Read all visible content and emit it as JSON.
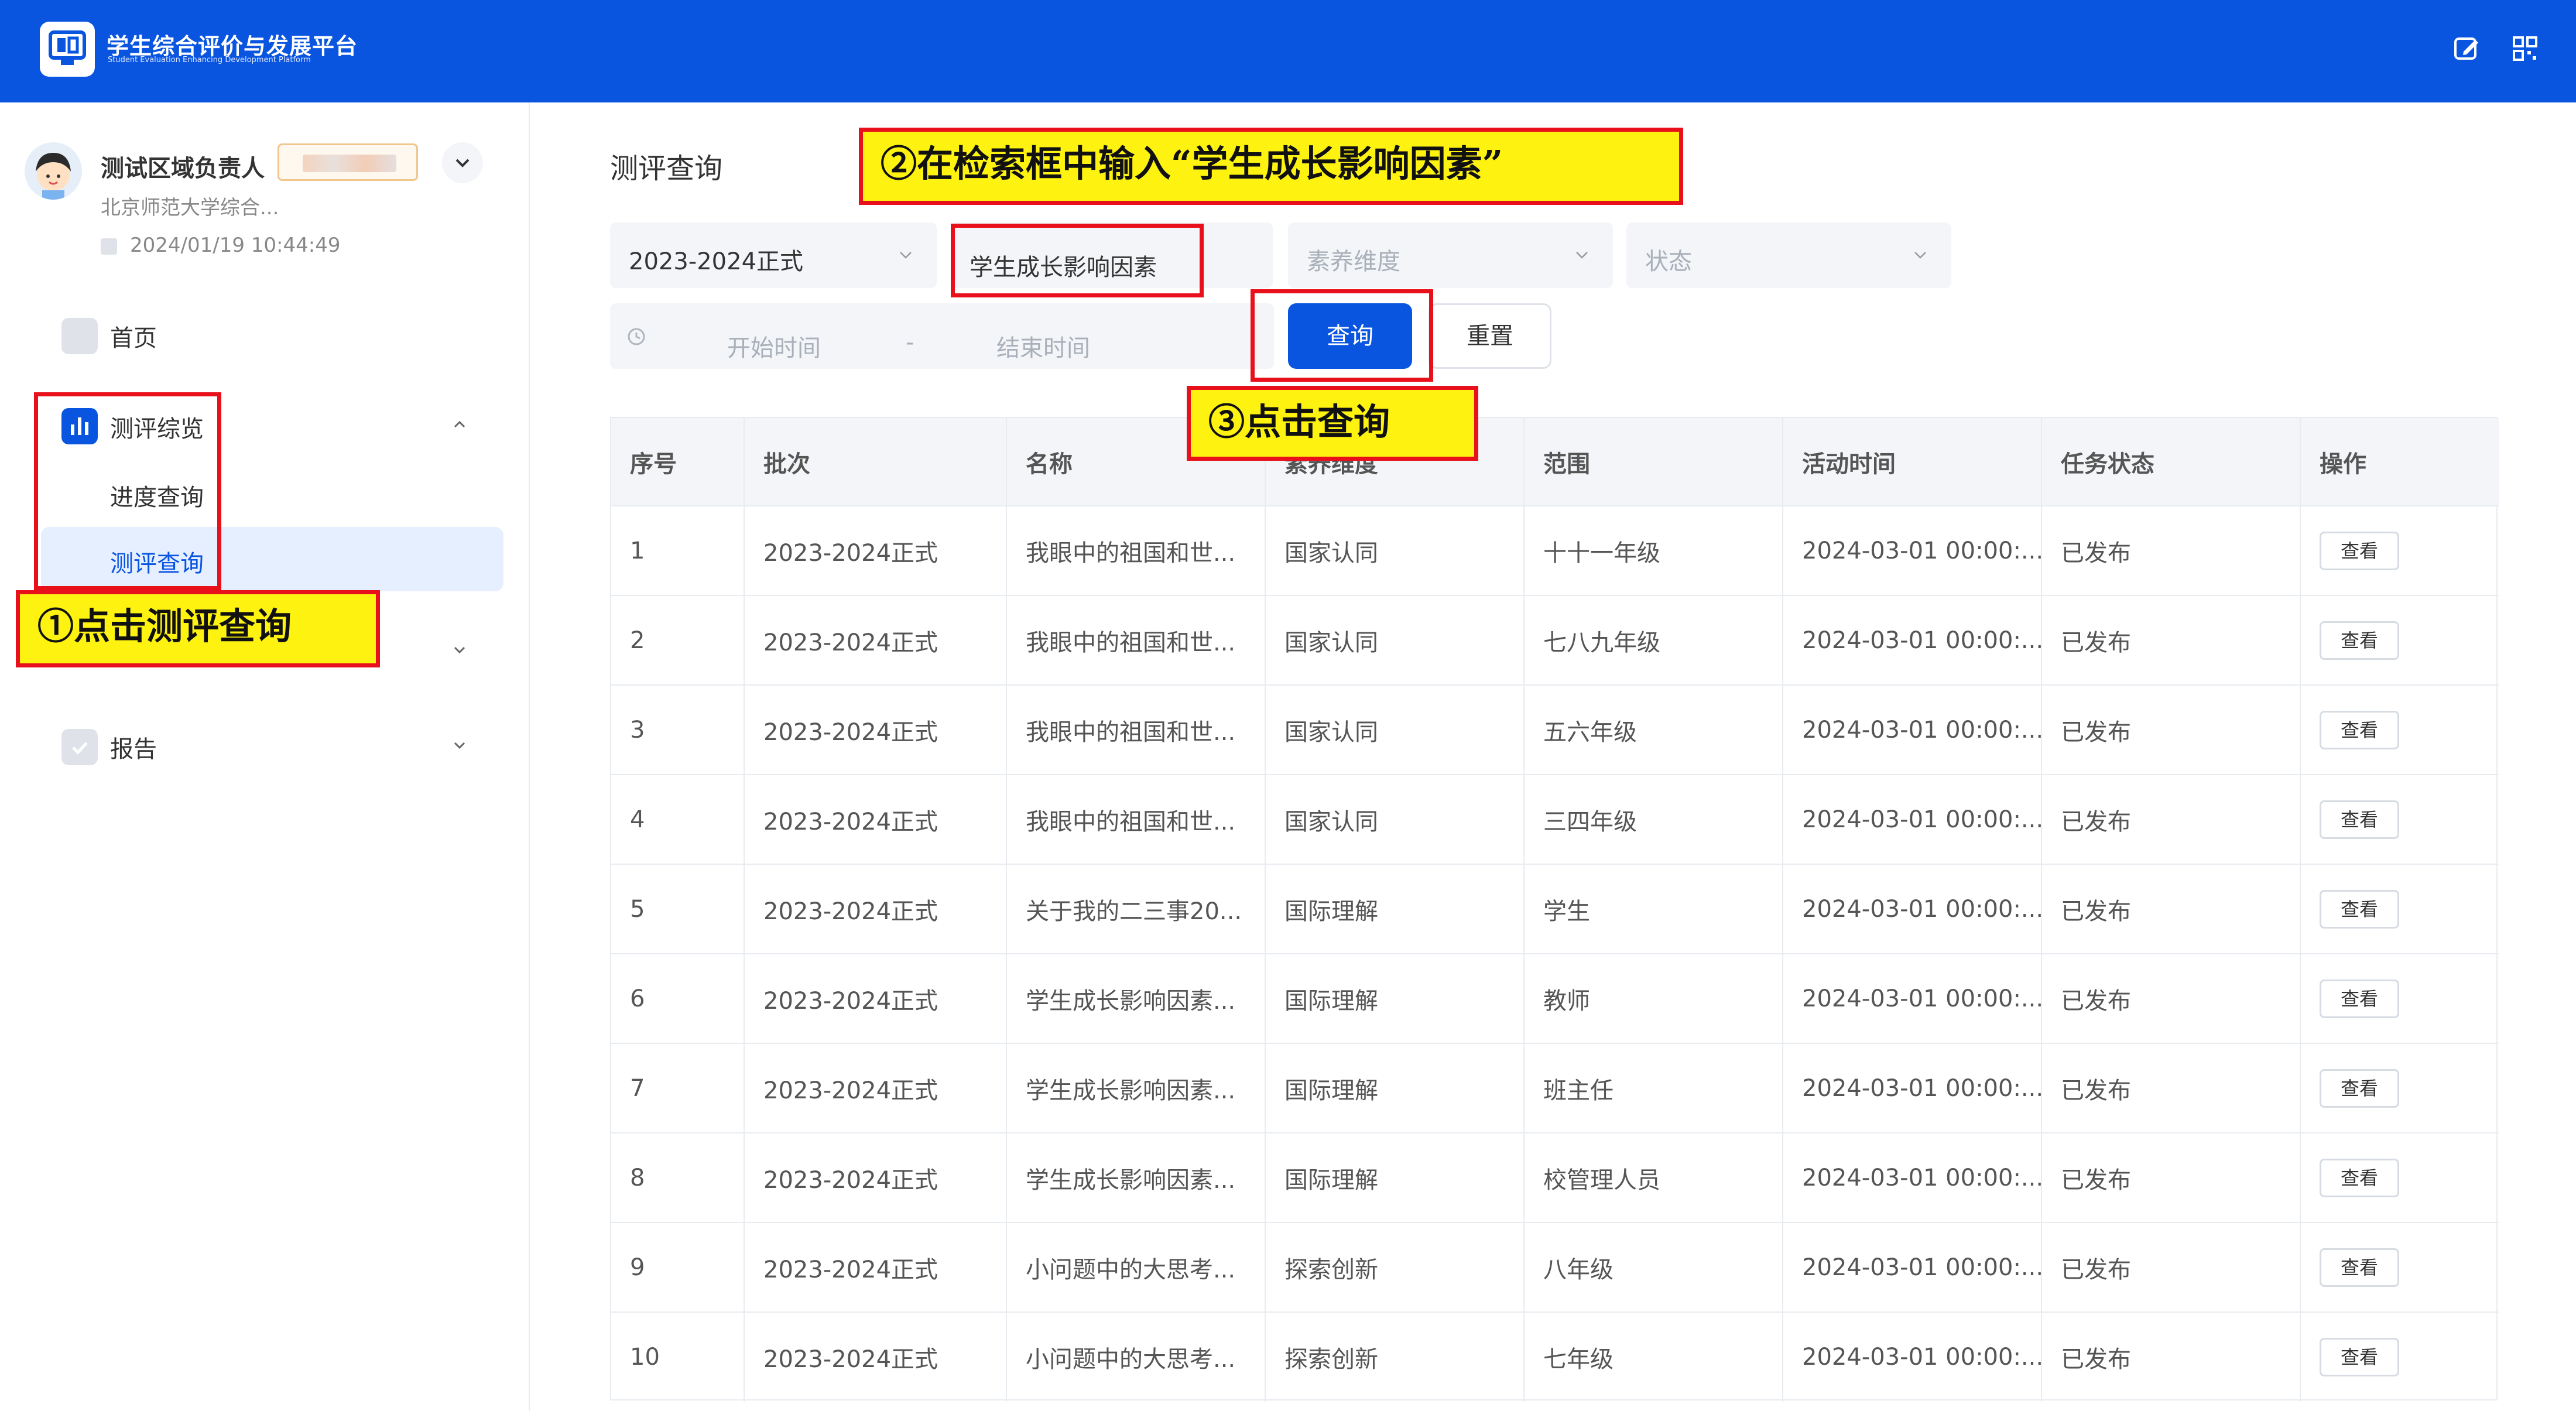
{
  "header": {
    "app_title": "学生综合评价与发展平台",
    "app_subtitle": "Student Evaluation Enhancing Development Platform",
    "icons": [
      "edit-icon",
      "qrcode-icon"
    ]
  },
  "user": {
    "name": "测试区域负责人",
    "org": "北京师范大学综合...",
    "login_time": "2024/01/19 10:44:49"
  },
  "sidebar": {
    "home": "首页",
    "evaluation_overview": "测评综览",
    "sub_items": [
      "进度查询",
      "测评查询"
    ],
    "report": "报告"
  },
  "main": {
    "title": "测评查询",
    "filters": {
      "batch_value": "2023-2024正式",
      "search_value": "学生成长影响因素",
      "dimension_placeholder": "素养维度",
      "status_placeholder": "状态",
      "start_time_placeholder": "开始时间",
      "range_sep": "-",
      "end_time_placeholder": "结束时间"
    },
    "buttons": {
      "query": "查询",
      "reset": "重置"
    },
    "table": {
      "headers": [
        "序号",
        "批次",
        "名称",
        "素养维度",
        "范围",
        "活动时间",
        "任务状态",
        "操作"
      ],
      "rows": [
        [
          "1",
          "2023-2024正式",
          "我眼中的祖国和世...",
          "国家认同",
          "十十一年级",
          "2024-03-01 00:00:...",
          "已发布",
          "查看"
        ],
        [
          "2",
          "2023-2024正式",
          "我眼中的祖国和世...",
          "国家认同",
          "七八九年级",
          "2024-03-01 00:00:...",
          "已发布",
          "查看"
        ],
        [
          "3",
          "2023-2024正式",
          "我眼中的祖国和世...",
          "国家认同",
          "五六年级",
          "2024-03-01 00:00:...",
          "已发布",
          "查看"
        ],
        [
          "4",
          "2023-2024正式",
          "我眼中的祖国和世...",
          "国家认同",
          "三四年级",
          "2024-03-01 00:00:...",
          "已发布",
          "查看"
        ],
        [
          "5",
          "2023-2024正式",
          "关于我的二三事20...",
          "国际理解",
          "学生",
          "2024-03-01 00:00:...",
          "已发布",
          "查看"
        ],
        [
          "6",
          "2023-2024正式",
          "学生成长影响因素...",
          "国际理解",
          "教师",
          "2024-03-01 00:00:...",
          "已发布",
          "查看"
        ],
        [
          "7",
          "2023-2024正式",
          "学生成长影响因素...",
          "国际理解",
          "班主任",
          "2024-03-01 00:00:...",
          "已发布",
          "查看"
        ],
        [
          "8",
          "2023-2024正式",
          "学生成长影响因素...",
          "国际理解",
          "校管理人员",
          "2024-03-01 00:00:...",
          "已发布",
          "查看"
        ],
        [
          "9",
          "2023-2024正式",
          "小问题中的大思考...",
          "探索创新",
          "八年级",
          "2024-03-01 00:00:...",
          "已发布",
          "查看"
        ],
        [
          "10",
          "2023-2024正式",
          "小问题中的大思考...",
          "探索创新",
          "七年级",
          "2024-03-01 00:00:...",
          "已发布",
          "查看"
        ]
      ]
    }
  },
  "annotations": {
    "step1": "①点击测评查询",
    "step2": "②在检索框中输入“学生成长影响因素”",
    "step3": "③点击查询"
  },
  "colors": {
    "brand": "#0a55e0",
    "annotation_red": "#e8101a",
    "annotation_yellow": "#fdf210"
  }
}
